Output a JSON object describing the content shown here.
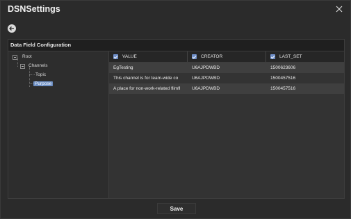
{
  "window": {
    "title": "DSNSettings"
  },
  "panel": {
    "title": "Data Field Configuration"
  },
  "tree": {
    "root_label": "Root",
    "channels_label": "Channels",
    "topic_label": "Topic",
    "purpose_label": "Purpose",
    "selected": "Purpose"
  },
  "grid": {
    "columns": [
      {
        "label": "VALUE",
        "checked": true
      },
      {
        "label": "CREATOR",
        "checked": true
      },
      {
        "label": "LAST_SET",
        "checked": true
      }
    ],
    "rows": [
      {
        "value": "EgTesting",
        "creator": "U6AJPDWBD",
        "last_set": "1500623606"
      },
      {
        "value": "This channel is for team-wide co",
        "creator": "U6AJPDWBD",
        "last_set": "1500457516"
      },
      {
        "value": "A place for non-work-related flimfl",
        "creator": "U6AJPDWBD",
        "last_set": "1500457516"
      }
    ]
  },
  "footer": {
    "save_label": "Save"
  },
  "icons": {
    "close": "close-icon",
    "back": "back-arrow-icon"
  },
  "colors": {
    "accent": "#6f8fc9",
    "selection": "#6d8fc4",
    "background": "#2b2b2b"
  }
}
